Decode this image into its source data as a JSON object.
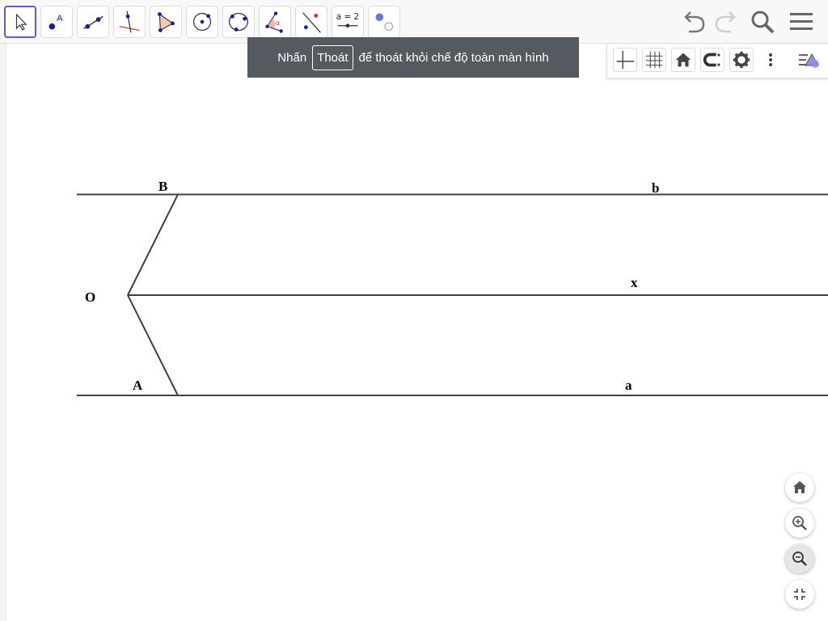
{
  "toolbar": {
    "tools": [
      {
        "name": "move",
        "icon": "cursor-arrow-icon",
        "selected": true
      },
      {
        "name": "point",
        "icon": "point-icon",
        "point_label": "A"
      },
      {
        "name": "line",
        "icon": "line-icon"
      },
      {
        "name": "perpendicular-line",
        "icon": "perpendicular-line-icon"
      },
      {
        "name": "polygon",
        "icon": "polygon-icon"
      },
      {
        "name": "circle",
        "icon": "circle-center-point-icon"
      },
      {
        "name": "ellipse",
        "icon": "circle-three-points-icon"
      },
      {
        "name": "angle",
        "icon": "angle-icon",
        "angle_symbol": "α"
      },
      {
        "name": "reflect",
        "icon": "reflect-icon"
      },
      {
        "name": "slider",
        "icon": "slider-icon",
        "slider_label": "a = 2"
      },
      {
        "name": "show-hide",
        "icon": "show-hide-object-icon"
      }
    ],
    "right": [
      "undo-icon",
      "redo-icon",
      "search-icon",
      "menu-icon"
    ]
  },
  "toast": {
    "prefix": "Nhấn",
    "key": "Thoát",
    "suffix": "để thoát khỏi chế độ toàn màn hình"
  },
  "style_bar": [
    "axes-icon",
    "grid-icon",
    "home-icon",
    "magnet-icon",
    "settings-icon",
    "more-icon",
    "style-bar-toggle-icon"
  ],
  "graphics": {
    "labels": {
      "B": "B",
      "b": "b",
      "O": "O",
      "x": "x",
      "A": "A",
      "a": "a"
    },
    "line_color": "#404040"
  },
  "zoom_controls": [
    "home-icon",
    "zoom-in-icon",
    "zoom-out-icon",
    "exit-fullscreen-icon"
  ],
  "colors": {
    "accent": "#6557d2",
    "point": "#1a1aa8",
    "toast_bg": "#555a60"
  }
}
